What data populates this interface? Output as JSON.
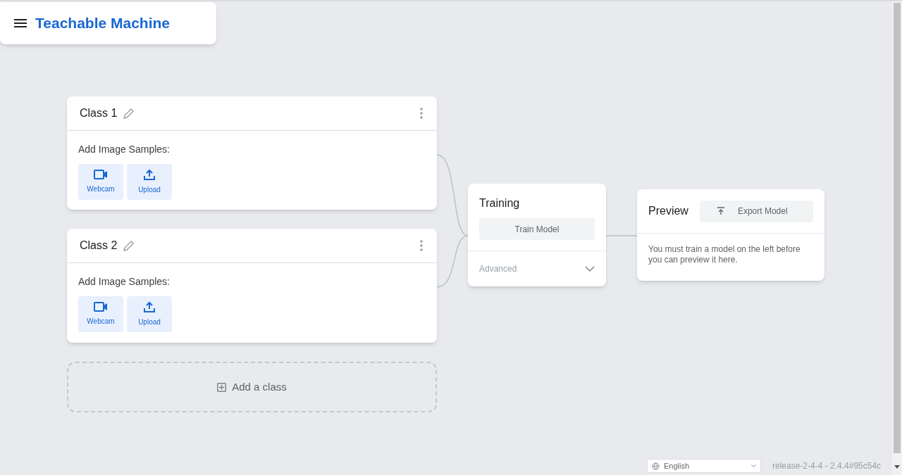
{
  "header": {
    "title": "Teachable Machine"
  },
  "classes": [
    {
      "name": "Class 1",
      "samples_label": "Add Image Samples:",
      "sources": [
        {
          "kind": "webcam",
          "label": "Webcam"
        },
        {
          "kind": "upload",
          "label": "Upload"
        }
      ]
    },
    {
      "name": "Class 2",
      "samples_label": "Add Image Samples:",
      "sources": [
        {
          "kind": "webcam",
          "label": "Webcam"
        },
        {
          "kind": "upload",
          "label": "Upload"
        }
      ]
    }
  ],
  "add_class": {
    "label": "Add a class"
  },
  "training": {
    "title": "Training",
    "train_button": "Train Model",
    "advanced": {
      "label": "Advanced",
      "expanded": false
    }
  },
  "preview": {
    "title": "Preview",
    "export_button": "Export Model",
    "message": "You must train a model on the left before you can preview it here."
  },
  "footer": {
    "language": "English",
    "version": "release-2-4-4 - 2.4.4#95c54c"
  }
}
